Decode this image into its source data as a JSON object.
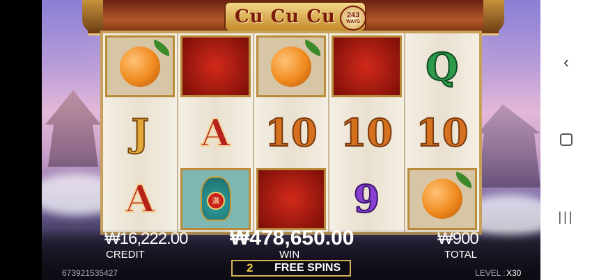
{
  "game": {
    "logo_text": "Cu Cu Cu 3",
    "ways_number": "243",
    "ways_word": "WAYS"
  },
  "reels": [
    [
      {
        "symbol": "orange",
        "label": ""
      },
      {
        "symbol": "letter",
        "label": "J",
        "color": "gold"
      },
      {
        "symbol": "letter",
        "label": "A",
        "color": "red"
      }
    ],
    [
      {
        "symbol": "golden-egg",
        "label": ""
      },
      {
        "symbol": "letter",
        "label": "A",
        "color": "red"
      },
      {
        "symbol": "vase",
        "label": "满"
      }
    ],
    [
      {
        "symbol": "orange",
        "label": ""
      },
      {
        "symbol": "letter",
        "label": "10",
        "color": "orange"
      },
      {
        "symbol": "golden-egg",
        "label": ""
      }
    ],
    [
      {
        "symbol": "golden-egg",
        "label": ""
      },
      {
        "symbol": "letter",
        "label": "10",
        "color": "orange"
      },
      {
        "symbol": "letter",
        "label": "9",
        "color": "purple"
      }
    ],
    [
      {
        "symbol": "letter",
        "label": "Q",
        "color": "green"
      },
      {
        "symbol": "letter",
        "label": "10",
        "color": "orange"
      },
      {
        "symbol": "orange",
        "label": ""
      }
    ]
  ],
  "hud": {
    "credit_value": "₩16,222.00",
    "credit_label": "CREDIT",
    "win_value": "₩478,650.00",
    "win_label": "WIN",
    "total_value": "₩900",
    "total_label": "TOTAL",
    "free_spins_count": "2",
    "free_spins_label": "FREE SPINS",
    "account_id": "673921535427",
    "level_label": "LEVEL :",
    "level_value": "X30"
  },
  "navbar": {
    "back_icon": "‹",
    "recent_icon": "|||"
  }
}
